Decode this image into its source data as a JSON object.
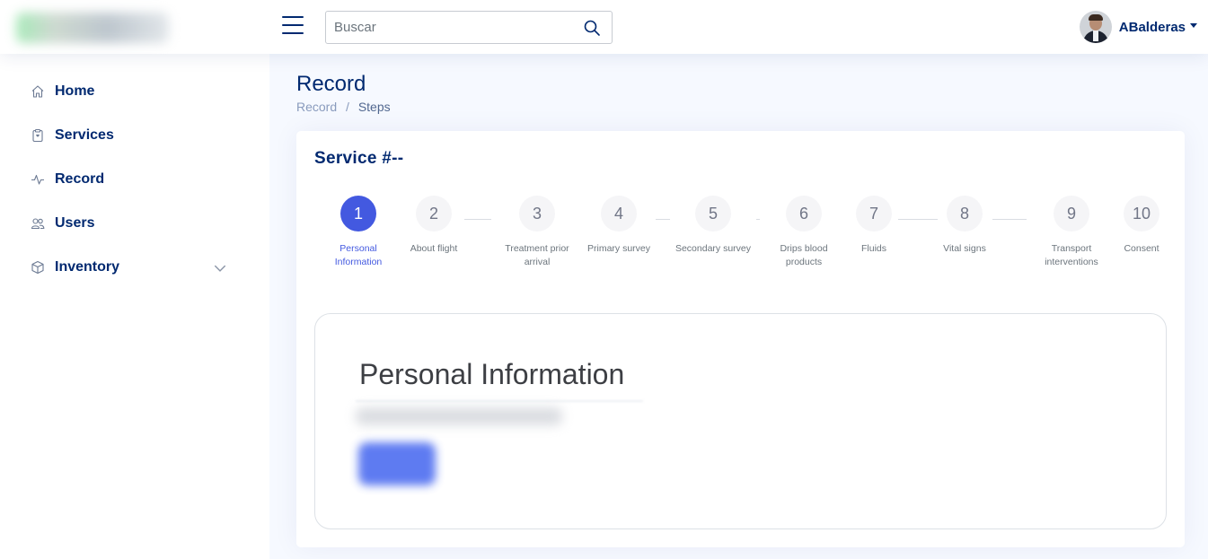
{
  "header": {
    "search": {
      "placeholder": "Buscar"
    },
    "profile": {
      "name": "ABalderas"
    }
  },
  "sidebar": {
    "items": [
      {
        "label": "Home",
        "icon": "home-icon"
      },
      {
        "label": "Services",
        "icon": "clipboard-icon"
      },
      {
        "label": "Record",
        "icon": "activity-icon"
      },
      {
        "label": "Users",
        "icon": "people-icon"
      },
      {
        "label": "Inventory",
        "icon": "box-icon",
        "expandable": true
      }
    ]
  },
  "page": {
    "title": "Record",
    "breadcrumb": [
      "Record",
      "Steps"
    ]
  },
  "card": {
    "title": "Service #--",
    "steps": [
      {
        "number": "1",
        "label": "Personal Information",
        "active": true
      },
      {
        "number": "2",
        "label": "About flight"
      },
      {
        "number": "3",
        "label": "Treatment prior arrival"
      },
      {
        "number": "4",
        "label": "Primary survey"
      },
      {
        "number": "5",
        "label": "Secondary survey"
      },
      {
        "number": "6",
        "label": "Drips blood products"
      },
      {
        "number": "7",
        "label": "Fluids"
      },
      {
        "number": "8",
        "label": "Vital signs"
      },
      {
        "number": "9",
        "label": "Transport interventions"
      },
      {
        "number": "10",
        "label": "Consent"
      }
    ],
    "section_title": "Personal Information"
  },
  "colors": {
    "primary_dark": "#012970",
    "accent": "#4359e0",
    "background": "#f6f9ff"
  }
}
